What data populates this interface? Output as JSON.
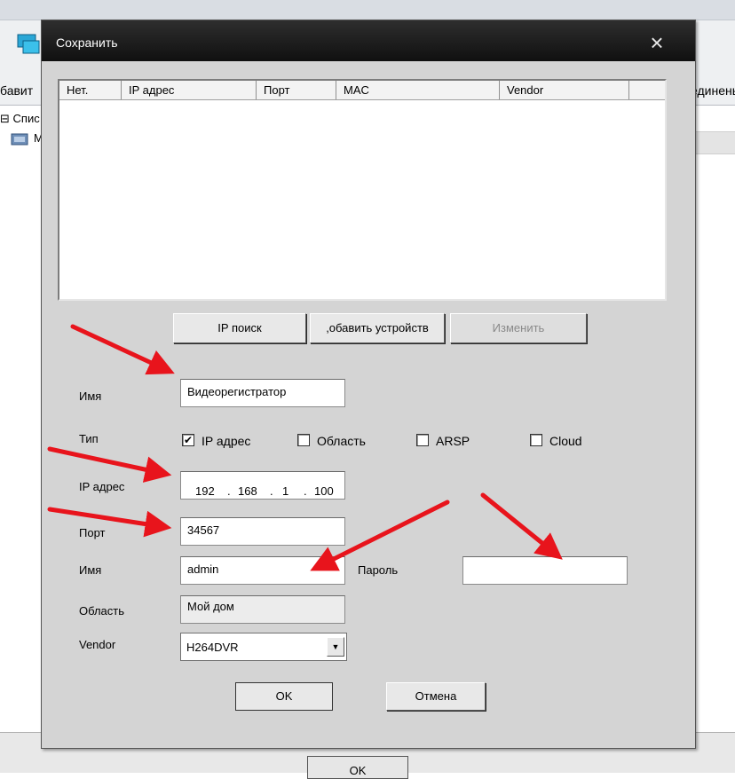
{
  "background": {
    "toolbar": {
      "add_label": "бавит",
      "connect_label": "единены"
    },
    "list_title": "Спис",
    "list_item_label": "М",
    "ok_label": "OK"
  },
  "dialog": {
    "title": "Сохранить",
    "close_icon": "×",
    "table": {
      "columns": [
        "Нет.",
        "IP адрес",
        "Порт",
        "MAC",
        "Vendor"
      ],
      "rows": []
    },
    "buttons": {
      "ip_search": "IP поиск",
      "add_device": ",обавить устройств",
      "edit": "Изменить",
      "ok": "OK",
      "cancel": "Отмена"
    },
    "form": {
      "name_label": "Имя",
      "name_value": "Видеорегистратор",
      "type_label": "Тип",
      "types": [
        {
          "label": "IP адрес",
          "checked": true
        },
        {
          "label": "Область",
          "checked": false
        },
        {
          "label": "ARSP",
          "checked": false
        },
        {
          "label": "Cloud",
          "checked": false
        }
      ],
      "ip_label": "IP адрес",
      "ip_octets": [
        "192",
        "168",
        "1",
        "100"
      ],
      "port_label": "Порт",
      "port_value": "34567",
      "user_label": "Имя",
      "user_value": "admin",
      "password_label": "Пароль",
      "password_value": "",
      "area_label": "Область",
      "area_value": "Мой дом",
      "vendor_label": "Vendor",
      "vendor_value": "H264DVR"
    }
  },
  "colors": {
    "annotation_arrow": "#e8141c",
    "titlebar": "#1a1a1a",
    "dialog_bg": "#d4d4d4"
  }
}
